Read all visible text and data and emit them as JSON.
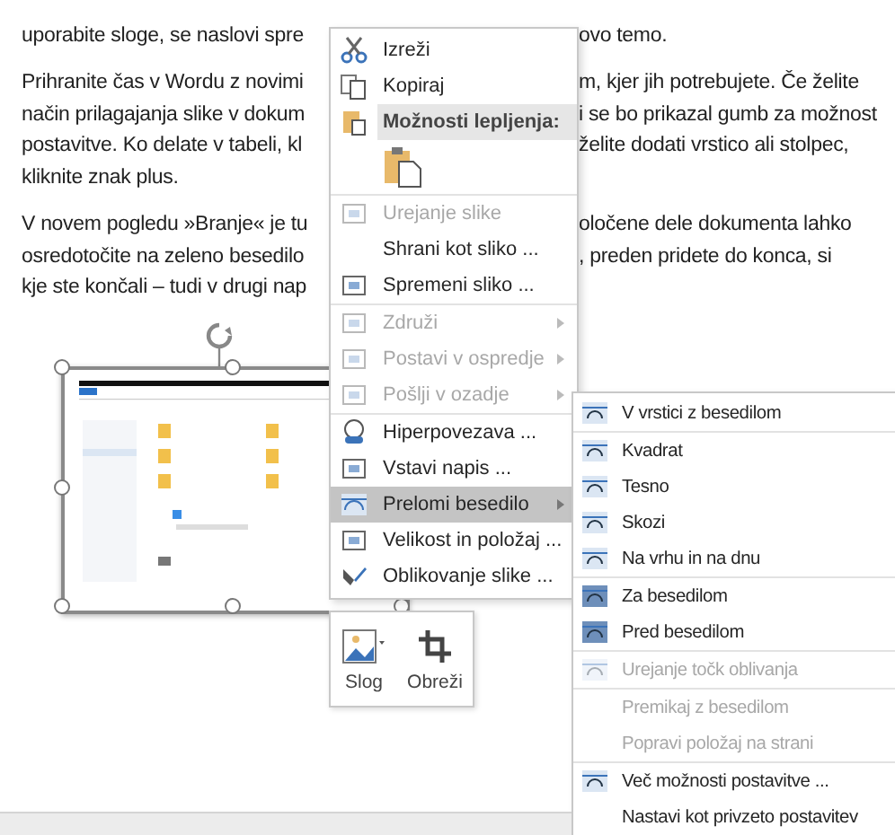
{
  "document": {
    "paragraphs": [
      {
        "lines": [
          {
            "left": "uporabite sloge, se naslovi spre",
            "right": "ovo temo."
          }
        ]
      },
      {
        "lines": [
          {
            "left": "Prihranite čas v Wordu z novimi",
            "right": "m, kjer jih potrebujete. Če želite"
          },
          {
            "left": "način prilagajanja slike v dokum",
            "right": "i se bo prikazal gumb za možnost"
          },
          {
            "left": "postavitve. Ko delate v tabeli, kl",
            "right": "želite dodati vrstico ali stolpec,"
          },
          {
            "left": "kliknite znak plus."
          }
        ]
      },
      {
        "lines": [
          {
            "left": "V novem pogledu »Branje« je tu",
            "right": "oločene dele dokumenta lahko"
          },
          {
            "left": "osredotočite na zeleno besedilo",
            "right": ", preden pridete do konca, si"
          },
          {
            "left": "kje ste končali – tudi v drugi nap"
          }
        ]
      }
    ]
  },
  "context_menu": {
    "groups": [
      [
        {
          "kind": "item",
          "label": "Izreži",
          "disabled": false,
          "submenu": false,
          "selected": false
        },
        {
          "kind": "item",
          "label": "Kopiraj",
          "disabled": false,
          "submenu": false,
          "selected": false
        },
        {
          "kind": "header",
          "label": "Možnosti lepljenja:"
        },
        {
          "kind": "paste-option"
        }
      ],
      [
        {
          "kind": "item",
          "label": "Urejanje slike",
          "disabled": true,
          "submenu": false,
          "selected": false
        },
        {
          "kind": "item",
          "label": "Shrani kot sliko ...",
          "disabled": false,
          "submenu": false,
          "selected": false
        },
        {
          "kind": "item",
          "label": "Spremeni sliko ...",
          "disabled": false,
          "submenu": false,
          "selected": false
        }
      ],
      [
        {
          "kind": "item",
          "label": "Združi",
          "disabled": true,
          "submenu": true,
          "selected": false
        },
        {
          "kind": "item",
          "label": "Postavi v ospredje",
          "disabled": true,
          "submenu": true,
          "selected": false
        },
        {
          "kind": "item",
          "label": "Pošlji v ozadje",
          "disabled": true,
          "submenu": true,
          "selected": false
        }
      ],
      [
        {
          "kind": "item",
          "label": "Hiperpovezava ...",
          "disabled": false,
          "submenu": false,
          "selected": false
        },
        {
          "kind": "item",
          "label": "Vstavi napis ...",
          "disabled": false,
          "submenu": false,
          "selected": false
        },
        {
          "kind": "item",
          "label": "Prelomi besedilo",
          "disabled": false,
          "submenu": true,
          "selected": true
        },
        {
          "kind": "item",
          "label": "Velikost in položaj ...",
          "disabled": false,
          "submenu": false,
          "selected": false
        },
        {
          "kind": "item",
          "label": "Oblikovanje slike ...",
          "disabled": false,
          "submenu": false,
          "selected": false
        }
      ]
    ]
  },
  "wrap_submenu": {
    "groups": [
      [
        {
          "label": "V vrstici z besedilom",
          "disabled": false,
          "icon": true
        }
      ],
      [
        {
          "label": "Kvadrat",
          "disabled": false,
          "icon": true
        },
        {
          "label": "Tesno",
          "disabled": false,
          "icon": true
        },
        {
          "label": "Skozi",
          "disabled": false,
          "icon": true
        },
        {
          "label": "Na vrhu in na dnu",
          "disabled": false,
          "icon": true
        }
      ],
      [
        {
          "label": "Za besedilom",
          "disabled": false,
          "icon": true
        },
        {
          "label": "Pred besedilom",
          "disabled": false,
          "icon": true
        }
      ],
      [
        {
          "label": "Urejanje točk oblivanja",
          "disabled": true,
          "icon": true
        }
      ],
      [
        {
          "label": "Premikaj z besedilom",
          "disabled": true,
          "icon": false
        },
        {
          "label": "Popravi položaj na strani",
          "disabled": true,
          "icon": false
        }
      ],
      [
        {
          "label": "Več možnosti postavitve ...",
          "disabled": false,
          "icon": true
        },
        {
          "label": "Nastavi kot privzeto postavitev",
          "disabled": false,
          "icon": false
        }
      ]
    ]
  },
  "mini_toolbar": {
    "buttons": [
      {
        "label": "Slog"
      },
      {
        "label": "Obreži"
      }
    ]
  }
}
